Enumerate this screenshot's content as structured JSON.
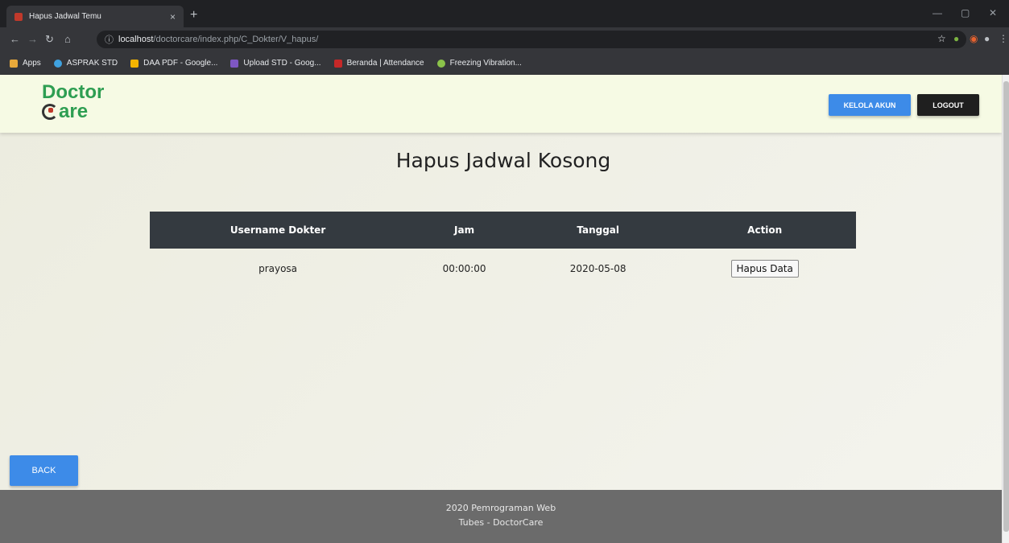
{
  "browser": {
    "tab_title": "Hapus Jadwal Temu",
    "tab_close": "×",
    "new_tab": "+",
    "url_host": "localhost",
    "url_path": "/doctorcare/index.php/C_Dokter/V_hapus/",
    "bookmarks": [
      {
        "label": "Apps",
        "color": "#e8a93a"
      },
      {
        "label": "ASPRAK STD",
        "color": "#3fa2e0"
      },
      {
        "label": "DAA PDF - Google...",
        "color": "#f4b400"
      },
      {
        "label": "Upload STD - Goog...",
        "color": "#7e57c2"
      },
      {
        "label": "Beranda | Attendance",
        "color": "#c62828"
      },
      {
        "label": "Freezing Vibration...",
        "color": "#8bc34a"
      }
    ]
  },
  "header": {
    "logo_line1": "Doctor",
    "logo_line2": "are",
    "kelola_label": "KELOLA AKUN",
    "logout_label": "LOGOUT"
  },
  "main": {
    "title": "Hapus Jadwal Kosong",
    "columns": [
      "Username Dokter",
      "Jam",
      "Tanggal",
      "Action"
    ],
    "rows": [
      {
        "username": "prayosa",
        "jam": "00:00:00",
        "tanggal": "2020-05-08",
        "action": "Hapus Data"
      }
    ],
    "back_label": "BACK"
  },
  "footer": {
    "line1": "2020 Pemrograman Web",
    "line2": "Tubes - DoctorCare"
  },
  "colors": {
    "primary": "#3d8be8",
    "dark": "#343a40",
    "logo_green": "#2e9e52",
    "footer": "#6b6b6b"
  }
}
